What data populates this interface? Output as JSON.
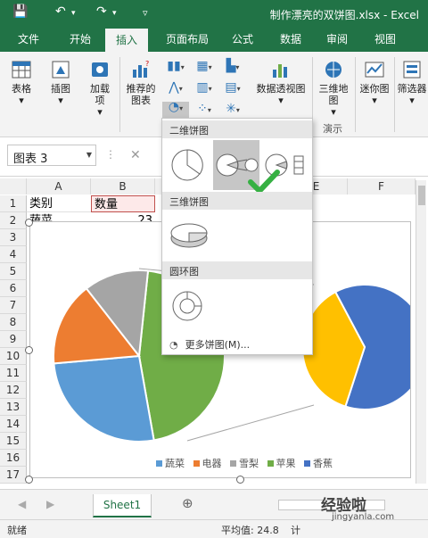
{
  "titlebar": {
    "title": "制作漂亮的双饼图.xlsx - Excel"
  },
  "tabs": [
    "文件",
    "开始",
    "插入",
    "页面布局",
    "公式",
    "数据",
    "审阅",
    "视图"
  ],
  "active_tab": "插入",
  "ribbon": {
    "table": "表格",
    "illustrations": "插图",
    "addins": "加载项",
    "recommended_charts": "推荐的图表",
    "pivot_chart": "数据透视图",
    "map3d": "三维地图",
    "sparkline": "迷你图",
    "filter": "筛选器",
    "tours_group": "演示"
  },
  "formula_bar": {
    "name_box": "图表 3",
    "cancel_symbol": "✕"
  },
  "columns": [
    "A",
    "B",
    "E",
    "F"
  ],
  "rows": [
    "1",
    "2",
    "3",
    "4",
    "5",
    "6",
    "7",
    "8",
    "9",
    "10",
    "11",
    "12",
    "13",
    "14",
    "15",
    "16",
    "17"
  ],
  "cells": {
    "a1": "类别",
    "b1": "数量",
    "a2": "蔬菜",
    "b2": "23"
  },
  "dropdown": {
    "section_2d": "二维饼图",
    "section_3d": "三维饼图",
    "section_donut": "圆环图",
    "more": "更多饼图(M)..."
  },
  "chart_data": {
    "type": "pie",
    "categories": [
      "蔬菜",
      "电器",
      "雪梨",
      "苹果",
      "香蕉"
    ],
    "colors": [
      "#5b9bd5",
      "#ed7d31",
      "#a5a5a5",
      "#70ad47",
      "#4472c4"
    ],
    "secondary_colors": [
      "#ffc000",
      "#4472c4"
    ]
  },
  "sheet_tab": "Sheet1",
  "status": {
    "ready": "就绪",
    "average": "平均值: 24.8",
    "count": "计"
  },
  "watermark": {
    "main": "经验啦",
    "sub": "jingyanla.com"
  }
}
